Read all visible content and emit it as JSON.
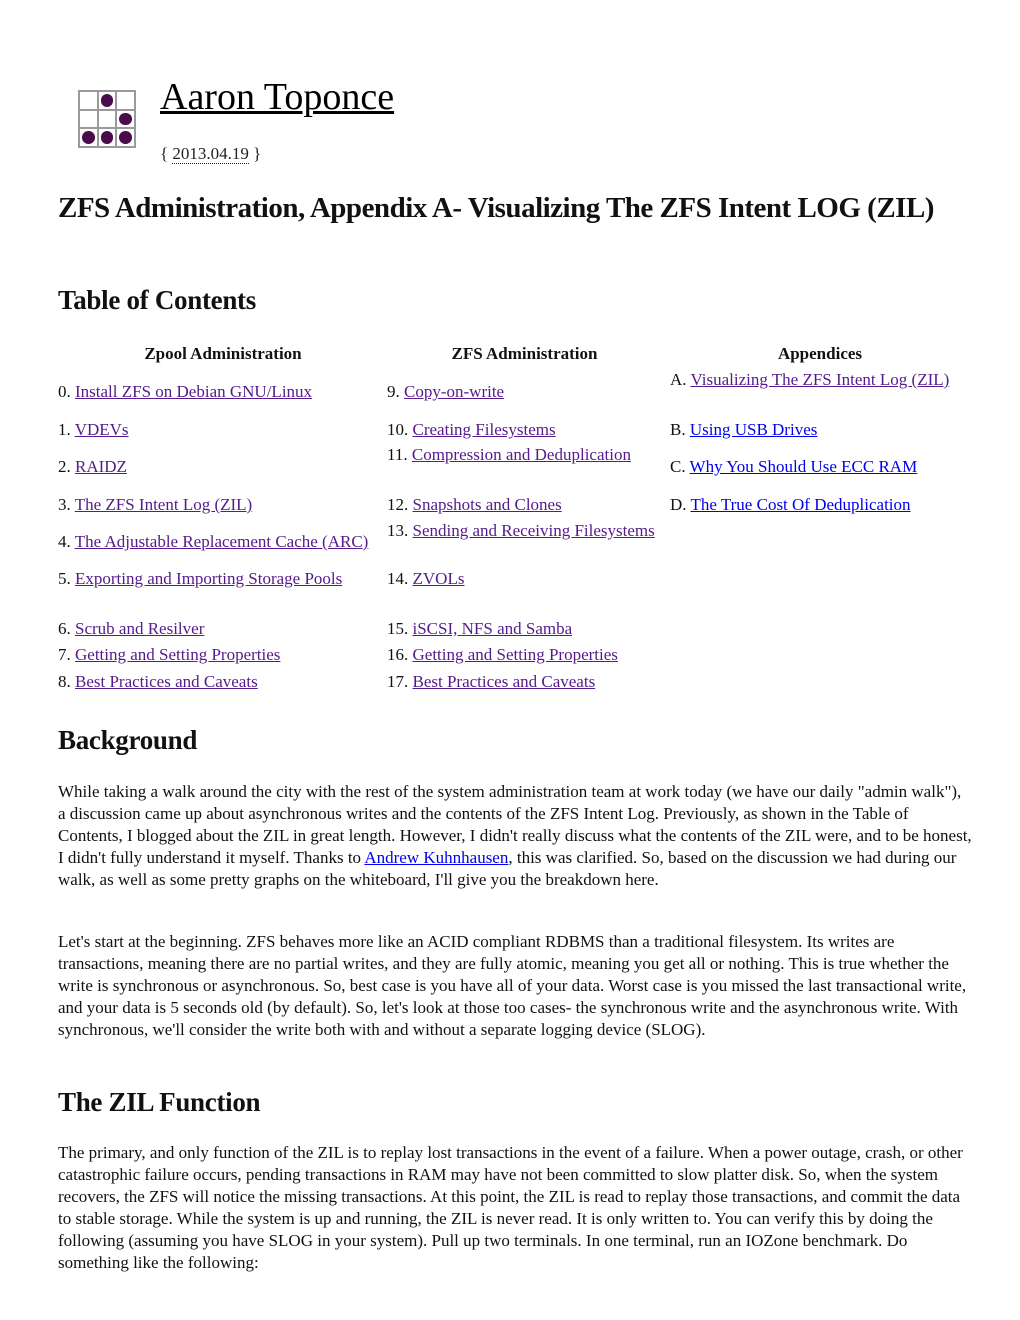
{
  "header": {
    "site_title": "Aaron Toponce",
    "date_open": "{ ",
    "date": "2013.04.19",
    "date_close": " }",
    "logo_icon": "glider-emblem-icon",
    "logo_cells": [
      false,
      true,
      false,
      false,
      false,
      true,
      true,
      true,
      true
    ],
    "logo_dot_color": "#4b0c4b"
  },
  "post": {
    "title": "ZFS Administration, Appendix A- Visualizing The ZFS Intent LOG (ZIL)"
  },
  "toc": {
    "heading": "Table of Contents",
    "columns": [
      {
        "header": "Zpool Administration",
        "items": [
          {
            "num": "0. ",
            "label": "Install ZFS on Debian GNU/Linux",
            "visited": true
          },
          {
            "num": "1. ",
            "label": "VDEVs",
            "visited": true
          },
          {
            "num": "2. ",
            "label": "RAIDZ",
            "visited": true
          },
          {
            "num": "3. ",
            "label": "The ZFS Intent Log (ZIL)",
            "visited": true
          },
          {
            "num": "4. ",
            "label": "The Adjustable Replacement Cache (ARC)",
            "visited": true
          },
          {
            "num": "5. ",
            "label": "Exporting and Importing Storage Pools",
            "visited": true
          },
          {
            "num": "6. ",
            "label": "Scrub and Resilver",
            "visited": true
          },
          {
            "num": "7. ",
            "label": "Getting and Setting Properties",
            "visited": true
          },
          {
            "num": "8. ",
            "label": "Best Practices and Caveats",
            "visited": true
          }
        ]
      },
      {
        "header": "ZFS Administration",
        "items": [
          {
            "num": "9. ",
            "label": "Copy-on-write",
            "visited": true
          },
          {
            "num": "10. ",
            "label": "Creating Filesystems",
            "visited": true
          },
          {
            "num": "11. ",
            "label": "Compression and Deduplication",
            "visited": true
          },
          {
            "num": "12. ",
            "label": "Snapshots and Clones",
            "visited": true
          },
          {
            "num": "13. ",
            "label": "Sending and Receiving Filesystems",
            "visited": true
          },
          {
            "num": "14. ",
            "label": "ZVOLs",
            "visited": true
          },
          {
            "num": "15. ",
            "label": "iSCSI, NFS and Samba",
            "visited": true
          },
          {
            "num": "16. ",
            "label": "Getting and Setting Properties",
            "visited": true
          },
          {
            "num": "17. ",
            "label": "Best Practices and Caveats",
            "visited": true
          }
        ]
      },
      {
        "header": "Appendices",
        "items": [
          {
            "num": "A. ",
            "label": "Visualizing The ZFS Intent Log (ZIL)",
            "visited": true
          },
          {
            "num": "B. ",
            "label": "Using USB Drives",
            "visited": false
          },
          {
            "num": "C. ",
            "label": "Why You Should Use ECC RAM",
            "visited": false
          },
          {
            "num": "D. ",
            "label": "The True Cost Of Deduplication",
            "visited": false
          }
        ]
      }
    ]
  },
  "background": {
    "heading": "Background",
    "p1_before": "While taking a walk around the city with the rest of the system administration team at work today (we have our daily \"admin walk\"), a discussion came up about asynchronous writes and the contents of the ZFS Intent Log. Previously, as shown in the Table of Contents, I blogged about the ZIL in great length. However, I didn't really discuss what the contents of the ZIL were, and to be honest, I didn't fully understand it myself. Thanks to ",
    "p1_link": "Andrew Kuhnhausen",
    "p1_after": ", this was clarified. So, based on the discussion we had during our walk, as well as some pretty graphs on the whiteboard, I'll give you the breakdown here.",
    "p2": "Let's start at the beginning. ZFS behaves more like an ACID compliant RDBMS than a traditional filesystem. Its writes are transactions, meaning there are no partial writes, and they are fully atomic, meaning you get all or nothing. This is true whether the write is synchronous or asynchronous. So, best case is you have all of your data. Worst case is you missed the last transactional write, and your data is 5 seconds old (by default). So, let's look at those too cases- the synchronous write and the asynchronous write. With synchronous, we'll consider the write both with and without a separate logging device (SLOG)."
  },
  "zil_function": {
    "heading": "The ZIL Function",
    "p1": "The primary, and only function of the ZIL is to replay lost transactions in the event of a failure. When a power outage, crash, or other catastrophic failure occurs, pending transactions in RAM may have not been committed to slow platter disk. So, when the system recovers, the ZFS will notice the missing transactions. At this point, the ZIL is read to replay those transactions, and commit the data to stable storage. While the system is up and running, the ZIL is never read. It is only written to. You can verify this by doing the following (assuming you have SLOG in your system). Pull up two terminals. In one terminal, run an IOZone benchmark. Do something like the following:"
  },
  "colors": {
    "visited_link": "#551a8b",
    "unvisited_link": "#0000ee",
    "text": "#111111"
  }
}
